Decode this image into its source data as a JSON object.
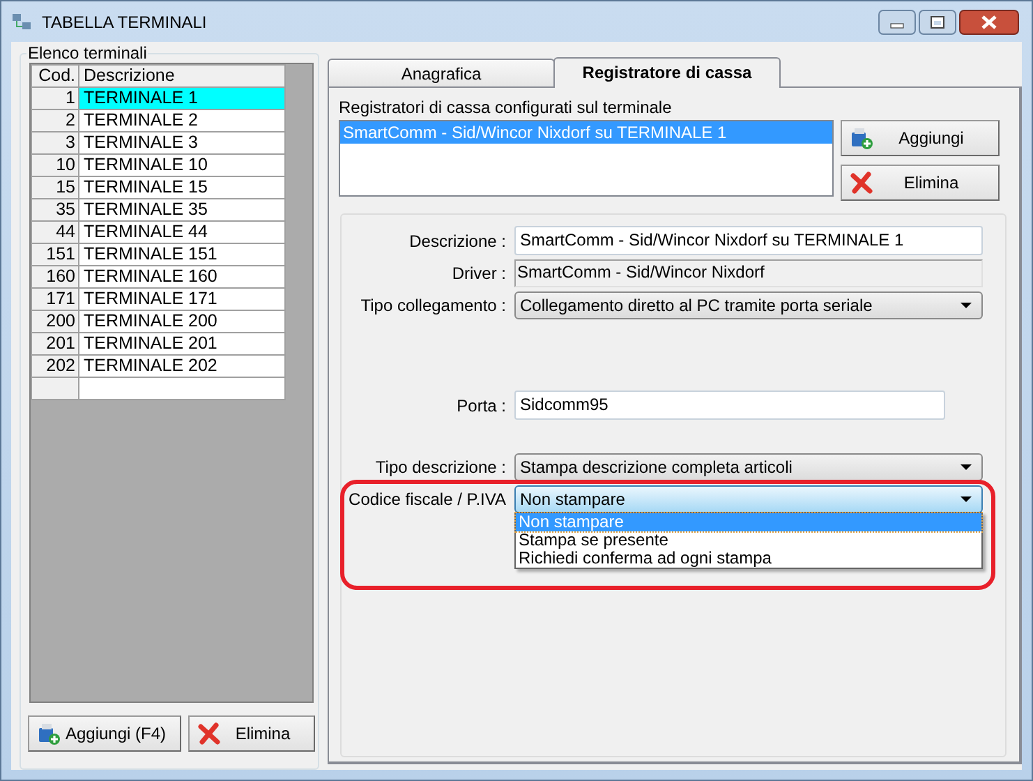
{
  "window": {
    "title": "TABELLA TERMINALI"
  },
  "terminals": {
    "title": "Elenco terminali",
    "columns": [
      "Cod.",
      "Descrizione"
    ],
    "rows": [
      {
        "code": "1",
        "name": "TERMINALE 1",
        "selected": true
      },
      {
        "code": "2",
        "name": "TERMINALE 2",
        "selected": false
      },
      {
        "code": "3",
        "name": "TERMINALE 3",
        "selected": false
      },
      {
        "code": "10",
        "name": "TERMINALE 10",
        "selected": false
      },
      {
        "code": "15",
        "name": "TERMINALE 15",
        "selected": false
      },
      {
        "code": "35",
        "name": "TERMINALE 35",
        "selected": false
      },
      {
        "code": "44",
        "name": "TERMINALE 44",
        "selected": false
      },
      {
        "code": "151",
        "name": "TERMINALE 151",
        "selected": false
      },
      {
        "code": "160",
        "name": "TERMINALE 160",
        "selected": false
      },
      {
        "code": "171",
        "name": "TERMINALE 171",
        "selected": false
      },
      {
        "code": "200",
        "name": "TERMINALE 200",
        "selected": false
      },
      {
        "code": "201",
        "name": "TERMINALE 201",
        "selected": false
      },
      {
        "code": "202",
        "name": "TERMINALE 202",
        "selected": false
      }
    ],
    "buttons": [
      {
        "label": "Aggiungi (F4)",
        "kind": "add"
      },
      {
        "label": "Elimina",
        "kind": "delete"
      }
    ]
  },
  "tabs": [
    {
      "label": "Anagrafica",
      "selected": false
    },
    {
      "label": "Registratore di cassa",
      "selected": true
    }
  ],
  "registers": {
    "label": "Registratori di cassa configurati sul terminale",
    "items": [
      {
        "text": "SmartComm - Sid/Wincor Nixdorf su TERMINALE 1",
        "selected": true
      }
    ],
    "buttons": [
      {
        "label": "Aggiungi",
        "kind": "add"
      },
      {
        "label": "Elimina",
        "kind": "delete"
      }
    ]
  },
  "form": {
    "sections": [
      [
        {
          "label": "Descrizione :",
          "value": "SmartComm - Sid/Wincor Nixdorf su TERMINALE 1",
          "kind": "text",
          "highlighted": false
        },
        {
          "label": "Driver :",
          "value": "SmartComm - Sid/Wincor Nixdorf",
          "kind": "readonly",
          "highlighted": false
        },
        {
          "label": "Tipo collegamento :",
          "value": "Collegamento diretto al PC tramite porta seriale",
          "kind": "combo",
          "focused": false,
          "highlighted": false
        }
      ],
      [
        {
          "label": "Porta :",
          "value": "Sidcomm95",
          "kind": "text",
          "highlighted": false
        }
      ],
      [
        {
          "label": "Tipo descrizione :",
          "value": "Stampa descrizione completa articoli",
          "kind": "combo",
          "focused": false,
          "highlighted": false
        },
        {
          "label": "Codice fiscale / P.IVA",
          "value": "Non stampare",
          "kind": "combo",
          "focused": true,
          "highlighted": true,
          "options": [
            {
              "text": "Non stampare",
              "selected": true
            },
            {
              "text": "Stampa se presente",
              "selected": false
            },
            {
              "text": "Richiedi conferma ad ogni stampa",
              "selected": false
            }
          ]
        }
      ]
    ]
  }
}
